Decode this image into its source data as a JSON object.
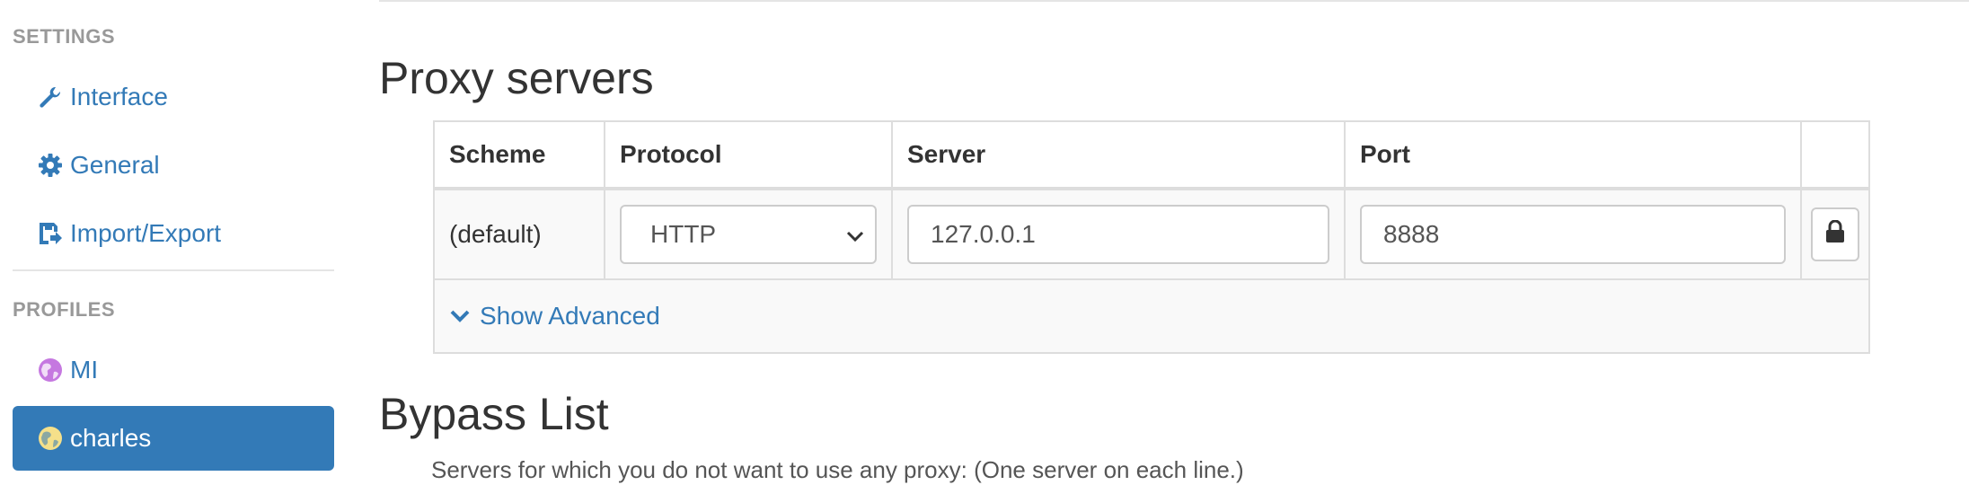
{
  "sidebar": {
    "settings_header": "SETTINGS",
    "settings_items": [
      {
        "label": "Interface",
        "icon": "wrench-icon"
      },
      {
        "label": "General",
        "icon": "gear-icon"
      },
      {
        "label": "Import/Export",
        "icon": "floppy-disk-icon"
      }
    ],
    "profiles_header": "PROFILES",
    "profiles_items": [
      {
        "label": "MI",
        "icon": "globe-icon",
        "color": "#c578e0"
      },
      {
        "label": "charles",
        "icon": "globe-icon",
        "color": "#f5e08a",
        "active": true
      }
    ]
  },
  "main": {
    "proxy_title": "Proxy servers",
    "table": {
      "headers": [
        "Scheme",
        "Protocol",
        "Server",
        "Port"
      ],
      "row": {
        "scheme": "(default)",
        "protocol": "HTTP",
        "server": "127.0.0.1",
        "port": "8888"
      },
      "show_advanced": "Show Advanced"
    },
    "bypass_title": "Bypass List",
    "bypass_help": "Servers for which you do not want to use any proxy: (One server on each line.)"
  },
  "colors": {
    "accent": "#337ab7",
    "header_muted": "#999999"
  }
}
